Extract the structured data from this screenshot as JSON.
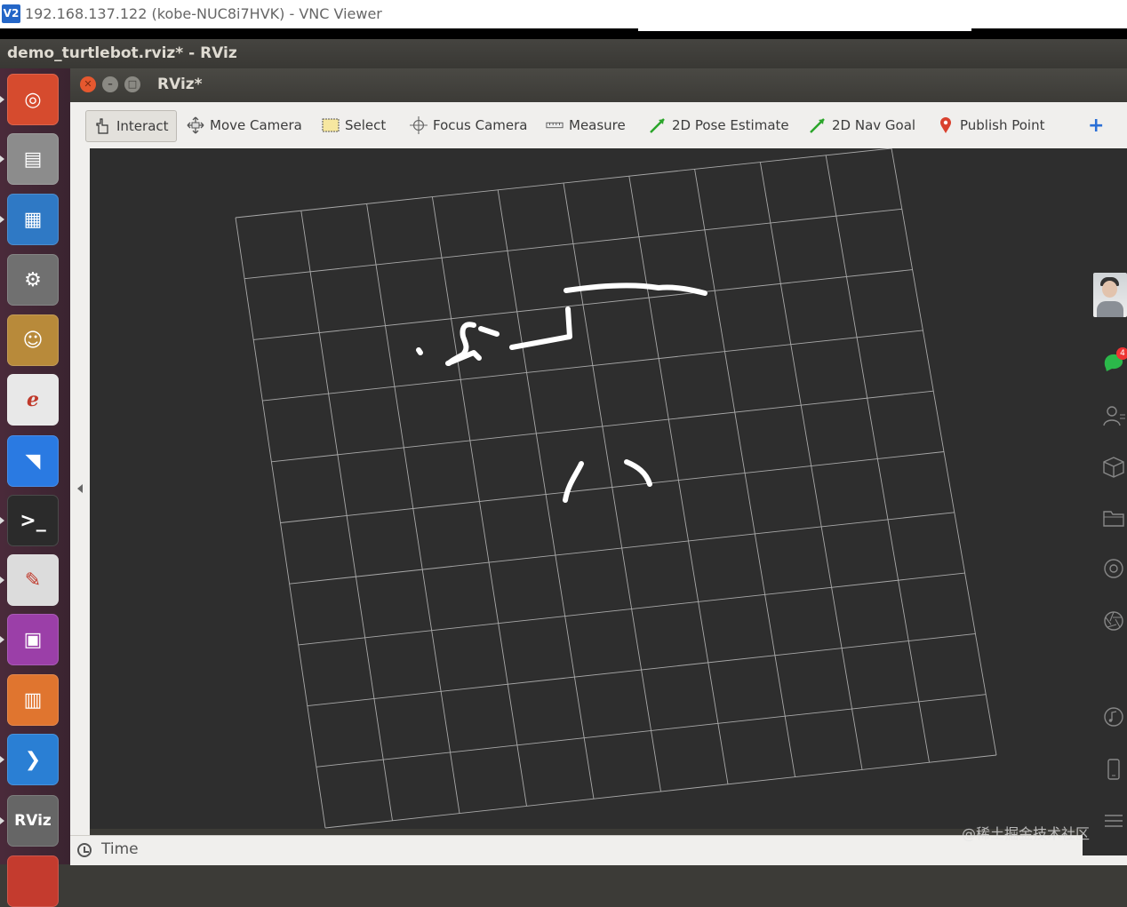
{
  "vnc": {
    "title": "192.168.137.122 (kobe-NUC8i7HVK) - VNC Viewer",
    "logo": "V2"
  },
  "desktop": {
    "window_title": "demo_turtlebot.rviz* - RViz"
  },
  "launcher": {
    "items": [
      {
        "name": "ubuntu-dash-icon",
        "color": "#d64b2e",
        "glyph": "◎"
      },
      {
        "name": "files-icon",
        "color": "#8c8c8c",
        "glyph": "▤"
      },
      {
        "name": "document-viewer-icon",
        "color": "#2f79c5",
        "glyph": "▦"
      },
      {
        "name": "system-settings-icon",
        "color": "#707070",
        "glyph": "⚙"
      },
      {
        "name": "app-cat-icon",
        "color": "#b88a3a",
        "glyph": "☺"
      },
      {
        "name": "pdf-reader-icon",
        "color": "#e8e8e8",
        "glyph": "ℯ"
      },
      {
        "name": "lark-icon",
        "color": "#2a7ae2",
        "glyph": "◥"
      },
      {
        "name": "terminal-icon",
        "color": "#2b2b2b",
        "glyph": ">_"
      },
      {
        "name": "text-editor-icon",
        "color": "#dcdcdc",
        "glyph": "✎"
      },
      {
        "name": "remote-desktop-icon",
        "color": "#9b3fa8",
        "glyph": "▣"
      },
      {
        "name": "file-manager-icon",
        "color": "#e0752f",
        "glyph": "▥"
      },
      {
        "name": "vscode-icon",
        "color": "#2a7fd4",
        "glyph": "❯"
      },
      {
        "name": "rviz-icon",
        "color": "#666666",
        "glyph": "RViz"
      },
      {
        "name": "partial-icon",
        "color": "#c43b2e",
        "glyph": ""
      }
    ]
  },
  "rviz": {
    "title": "RViz*",
    "toolbar": {
      "interact": "Interact",
      "move_camera": "Move Camera",
      "select": "Select",
      "focus_camera": "Focus Camera",
      "measure": "Measure",
      "pose_estimate": "2D Pose Estimate",
      "nav_goal": "2D Nav Goal",
      "publish_point": "Publish Point",
      "add_tool": "+"
    },
    "status": {
      "time_label": "Time"
    }
  },
  "sidebar": {
    "badge": "4"
  },
  "watermark": "@稀土掘金技术社区"
}
